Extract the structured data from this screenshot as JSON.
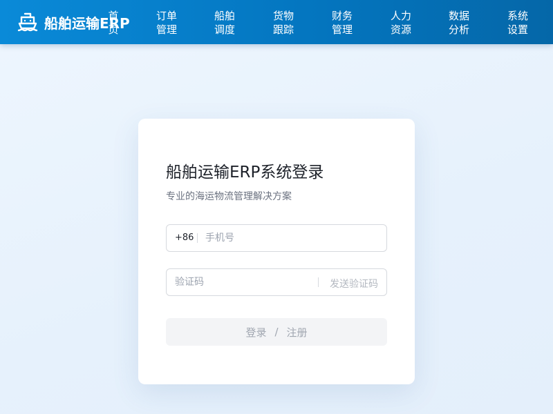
{
  "header": {
    "brand": "船舶运输ERP",
    "brand_icon": "ship-icon",
    "nav": [
      {
        "line1": "首",
        "line2": "页"
      },
      {
        "line1": "订单",
        "line2": "管理"
      },
      {
        "line1": "船舶",
        "line2": "调度"
      },
      {
        "line1": "货物",
        "line2": "跟踪"
      },
      {
        "line1": "财务",
        "line2": "管理"
      },
      {
        "line1": "人力",
        "line2": "资源"
      },
      {
        "line1": "数据",
        "line2": "分析"
      },
      {
        "line1": "系统",
        "line2": "设置"
      }
    ]
  },
  "login": {
    "title": "船舶运输ERP系统登录",
    "subtitle": "专业的海运物流管理解决方案",
    "phone_prefix": "+86",
    "phone_placeholder": "手机号",
    "code_placeholder": "验证码",
    "send_code": "发送验证码",
    "submit_login": "登录",
    "submit_sep": "/",
    "submit_register": "注册"
  },
  "colors": {
    "header_start": "#0a8ad8",
    "header_end": "#0567a8",
    "background": "#eef6fe",
    "card": "#ffffff",
    "button_bg": "#f3f4f6"
  }
}
